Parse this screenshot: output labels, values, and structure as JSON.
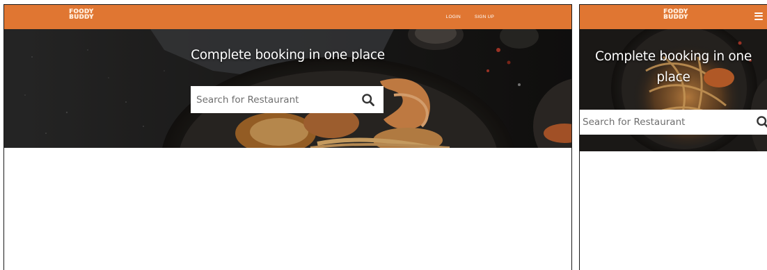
{
  "brand": {
    "logo_line1": "FOODY",
    "logo_line2": "BUDDY"
  },
  "nav": {
    "login": "LOGIN",
    "signup": "SIGN UP"
  },
  "hero": {
    "title": "Complete booking in one place",
    "search_placeholder": "Search for Restaurant"
  },
  "colors": {
    "navbar": "#e07632",
    "hero_overlay": "#1c1a18",
    "page_background": "#ffffff"
  },
  "icons": {
    "search": "search-icon",
    "menu": "hamburger-menu-icon"
  }
}
